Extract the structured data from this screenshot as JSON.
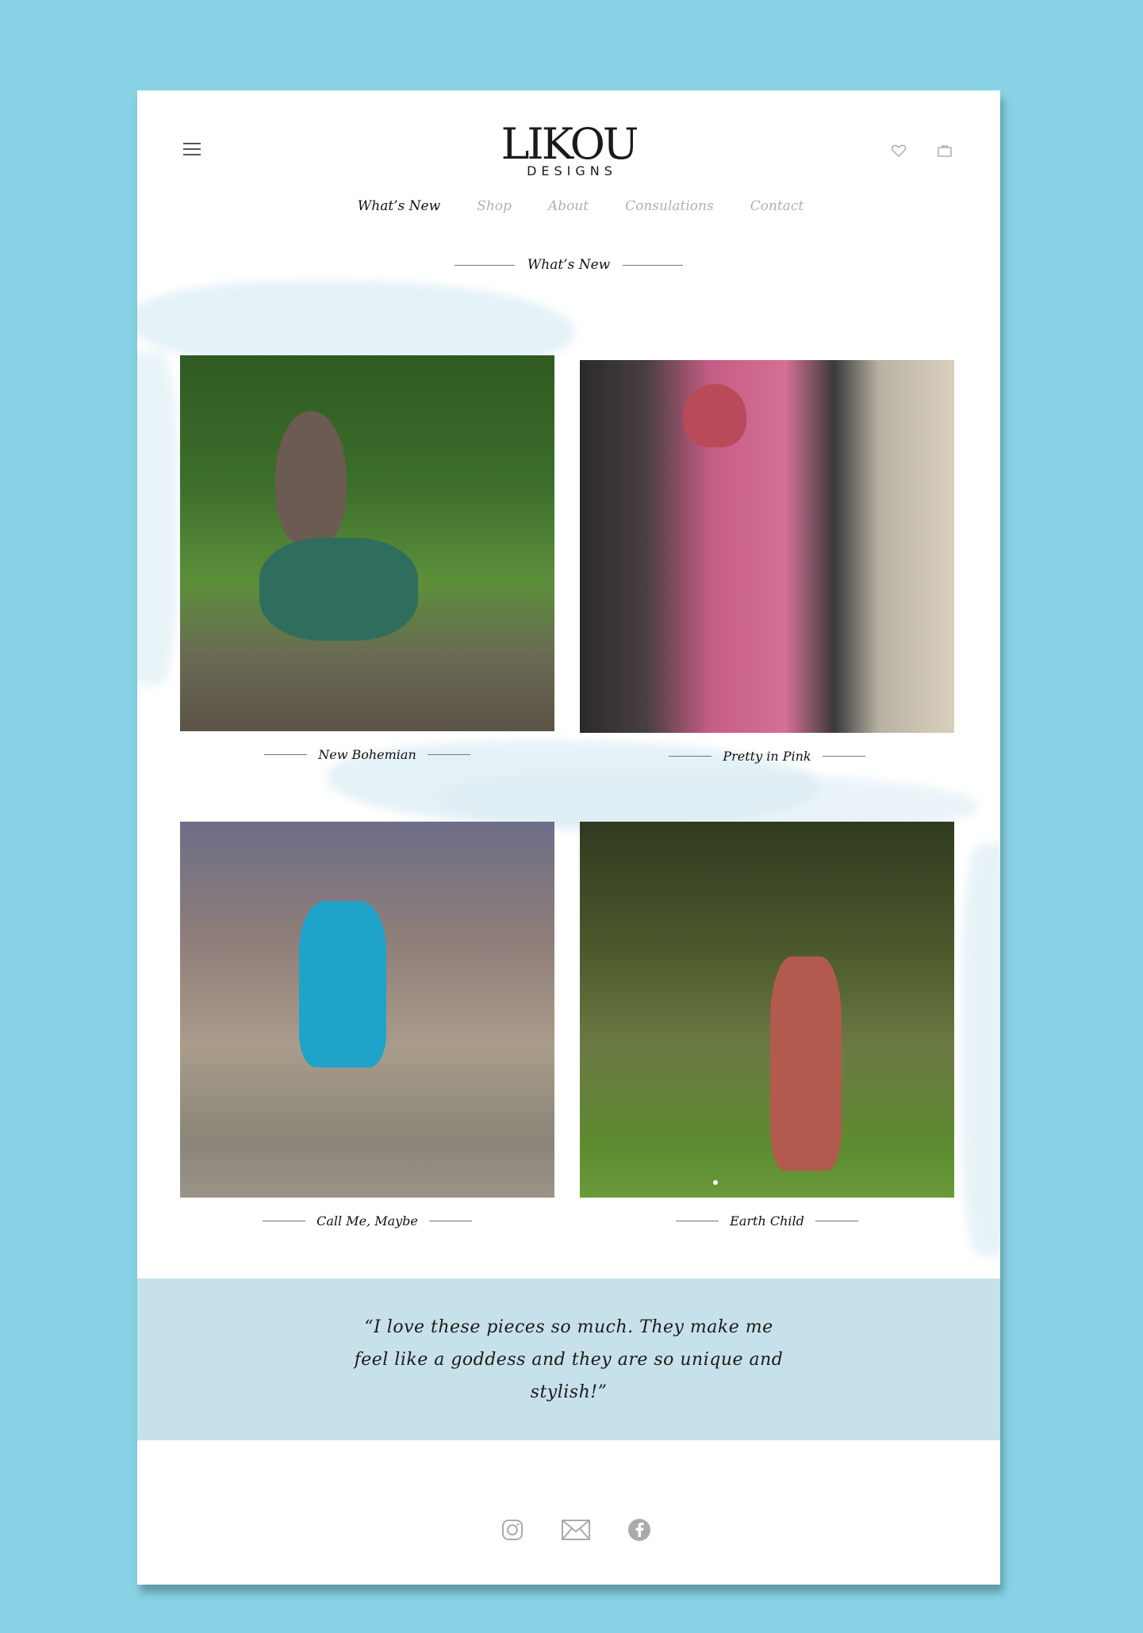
{
  "header": {
    "logo_main": "LIKOU",
    "logo_sub": "DESIGNS",
    "icons": [
      "menu-icon",
      "heart-icon",
      "bag-icon"
    ]
  },
  "nav": {
    "items": [
      {
        "label": "What’s New",
        "active": true
      },
      {
        "label": "Shop",
        "active": false
      },
      {
        "label": "About",
        "active": false
      },
      {
        "label": "Consulations",
        "active": false
      },
      {
        "label": "Contact",
        "active": false
      }
    ]
  },
  "section": {
    "title": "What’s New"
  },
  "cards": [
    {
      "caption": "New Bohemian"
    },
    {
      "caption": "Pretty in Pink"
    },
    {
      "caption": "Call Me, Maybe"
    },
    {
      "caption": "Earth Child"
    }
  ],
  "testimonial": {
    "text": "“I love these pieces so much. They make me feel like a goddess and they are so unique and stylish!”"
  },
  "footer": {
    "social_icons": [
      "instagram-icon",
      "mail-icon",
      "facebook-icon"
    ]
  },
  "colors": {
    "background": "#87d3e5",
    "quote_band": "#c7e1ea",
    "nav_inactive": "#b0b0b0"
  }
}
